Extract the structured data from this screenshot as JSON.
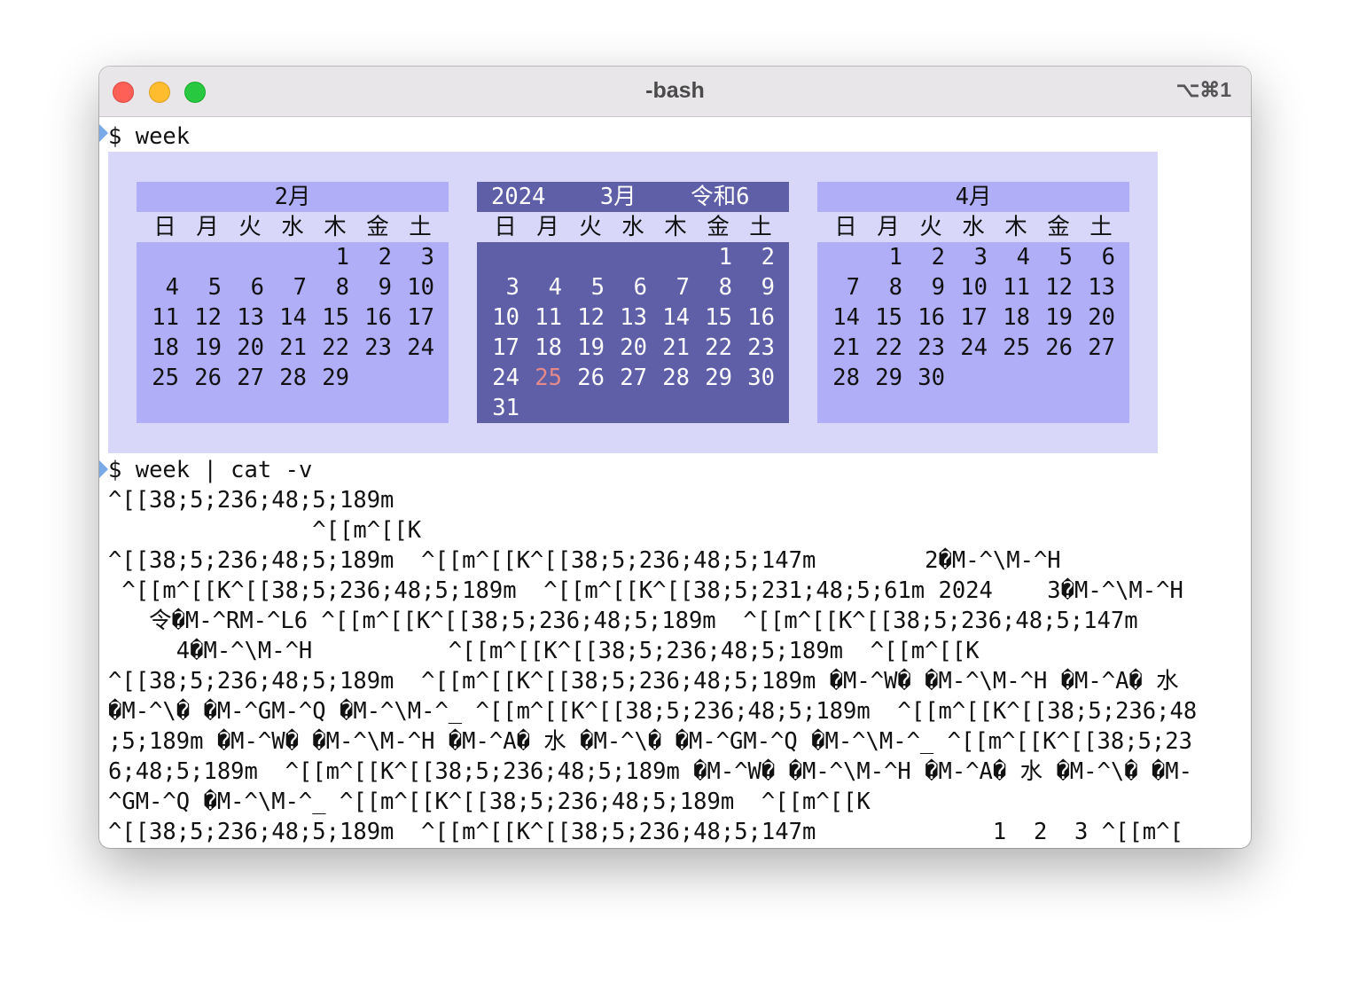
{
  "window": {
    "title": "-bash",
    "shortcut": "⌥⌘1"
  },
  "prompts": [
    {
      "prompt": "$",
      "command": "week"
    },
    {
      "prompt": "$",
      "command": "week | cat -v"
    }
  ],
  "calendar": {
    "weekday_labels": [
      "日",
      "月",
      "火",
      "水",
      "木",
      "金",
      "土"
    ],
    "months": [
      {
        "header": "2月",
        "is_current": false,
        "weeks": [
          [
            "",
            "",
            "",
            "",
            1,
            2,
            3
          ],
          [
            4,
            5,
            6,
            7,
            8,
            9,
            10
          ],
          [
            11,
            12,
            13,
            14,
            15,
            16,
            17
          ],
          [
            18,
            19,
            20,
            21,
            22,
            23,
            24
          ],
          [
            25,
            26,
            27,
            28,
            29,
            "",
            ""
          ]
        ]
      },
      {
        "header": "2024    3月    令和6",
        "year": "2024",
        "month": "3月",
        "era": "令和6",
        "is_current": true,
        "today": 25,
        "weeks": [
          [
            "",
            "",
            "",
            "",
            "",
            "",
            1,
            2
          ],
          [
            3,
            4,
            5,
            6,
            7,
            8,
            9
          ],
          [
            10,
            11,
            12,
            13,
            14,
            15,
            16
          ],
          [
            17,
            18,
            19,
            20,
            21,
            22,
            23
          ],
          [
            24,
            25,
            26,
            27,
            28,
            29,
            30
          ],
          [
            31,
            "",
            "",
            "",
            "",
            "",
            ""
          ]
        ]
      },
      {
        "header": "4月",
        "is_current": false,
        "weeks": [
          [
            "",
            1,
            2,
            3,
            4,
            5,
            6
          ],
          [
            7,
            8,
            9,
            10,
            11,
            12,
            13
          ],
          [
            14,
            15,
            16,
            17,
            18,
            19,
            20
          ],
          [
            21,
            22,
            23,
            24,
            25,
            26,
            27
          ],
          [
            28,
            29,
            30,
            "",
            "",
            "",
            ""
          ]
        ]
      }
    ],
    "colors": {
      "background": "#d8d7fa",
      "month_panel": "#afaef6",
      "current_month_panel": "#5f5fa8",
      "today": "#e48a8a"
    }
  },
  "cat_output": [
    "^[[38;5;236;48;5;189m",
    "               ^[[m^[[K",
    "^[[38;5;236;48;5;189m  ^[[m^[[K^[[38;5;236;48;5;147m        2�M-^\\M-^H",
    " ^[[m^[[K^[[38;5;236;48;5;189m  ^[[m^[[K^[[38;5;231;48;5;61m 2024    3�M-^\\M-^H",
    "   令�M-^RM-^L6 ^[[m^[[K^[[38;5;236;48;5;189m  ^[[m^[[K^[[38;5;236;48;5;147m",
    "     4�M-^\\M-^H          ^[[m^[[K^[[38;5;236;48;5;189m  ^[[m^[[K",
    "^[[38;5;236;48;5;189m  ^[[m^[[K^[[38;5;236;48;5;189m �M-^W� �M-^\\M-^H �M-^A� 水",
    "�M-^\\� �M-^GM-^Q �M-^\\M-^_ ^[[m^[[K^[[38;5;236;48;5;189m  ^[[m^[[K^[[38;5;236;48",
    ";5;189m �M-^W� �M-^\\M-^H �M-^A� 水 �M-^\\� �M-^GM-^Q �M-^\\M-^_ ^[[m^[[K^[[38;5;23",
    "6;48;5;189m  ^[[m^[[K^[[38;5;236;48;5;189m �M-^W� �M-^\\M-^H �M-^A� 水 �M-^\\� �M-",
    "^GM-^Q �M-^\\M-^_ ^[[m^[[K^[[38;5;236;48;5;189m  ^[[m^[[K",
    "^[[38;5;236;48;5;189m  ^[[m^[[K^[[38;5;236;48;5;147m             1  2  3 ^[[m^["
  ]
}
